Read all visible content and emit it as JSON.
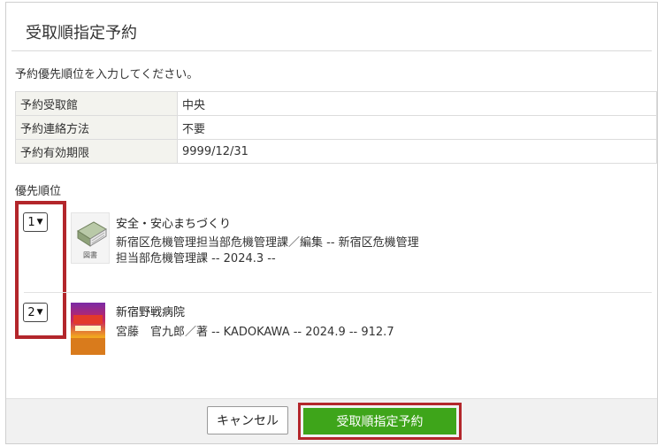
{
  "dialog": {
    "title": "受取順指定予約",
    "instruction": "予約優先順位を入力してください。"
  },
  "info_table": [
    {
      "label": "予約受取館",
      "value": "中央"
    },
    {
      "label": "予約連絡方法",
      "value": "不要"
    },
    {
      "label": "予約有効期限",
      "value": "9999/12/31"
    }
  ],
  "priority": {
    "label": "優先順位",
    "items": [
      {
        "order": "1",
        "icon": "book-icon",
        "icon_caption": "図書",
        "title": "安全・安心まちづくり",
        "meta_line1": "新宿区危機管理担当部危機管理課／編集 -- 新宿区危機管理",
        "meta_line2": "担当部危機管理課 -- 2024.3 --"
      },
      {
        "order": "2",
        "icon": "book-cover-image",
        "title": "新宿野戦病院",
        "meta_line1": "宮藤　官九郎／著 -- KADOKAWA -- 2024.9 -- 912.7"
      }
    ]
  },
  "footer": {
    "cancel_label": "キャンセル",
    "submit_label": "受取順指定予約"
  },
  "colors": {
    "highlight_border": "#b3262b",
    "submit_bg": "#3ea51a",
    "label_cell_bg": "#f3f3ee",
    "footer_bg": "#f1f1f1"
  }
}
